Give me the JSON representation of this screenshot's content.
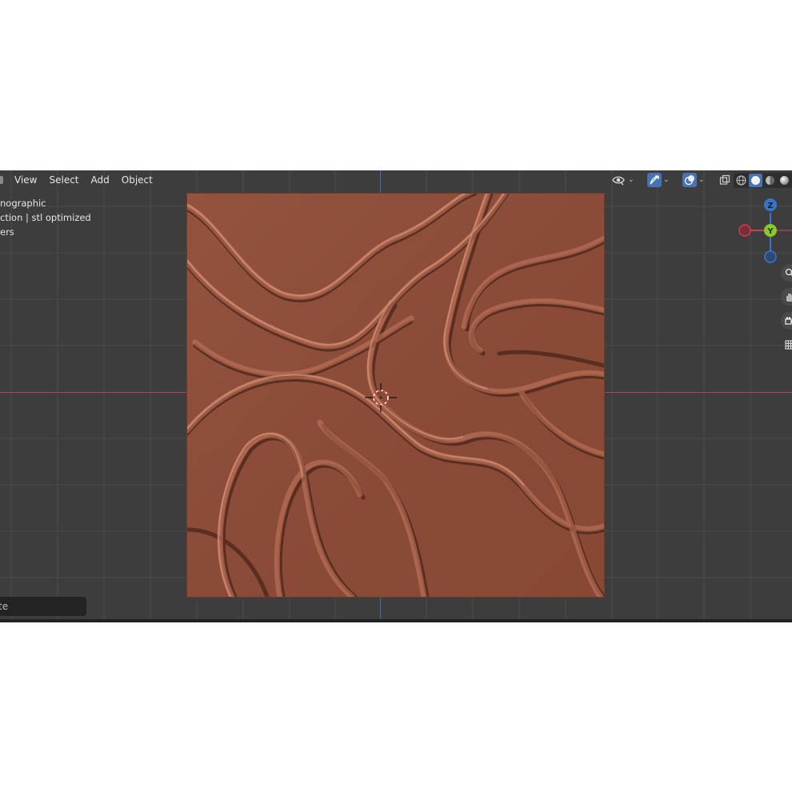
{
  "header": {
    "menu": [
      "View",
      "Select",
      "Add",
      "Object"
    ],
    "shading_modes": [
      {
        "name": "wireframe",
        "active": false
      },
      {
        "name": "solid",
        "active": true
      },
      {
        "name": "material-preview",
        "active": false
      },
      {
        "name": "rendered",
        "active": false
      }
    ]
  },
  "overlay": {
    "view_name": "nographic",
    "collection": "ction | stl optimized",
    "third_line": "ers"
  },
  "search": {
    "value": "te"
  },
  "gizmo": {
    "z_label": "Z",
    "y_label": "Y"
  },
  "colors": {
    "viewport_bg": "#3d3d3d",
    "panel": "#8a4c39",
    "x_axis": "#c9404f",
    "y_axis": "#8ac92c",
    "z_axis": "#3a76c4",
    "accent": "#4772b3"
  },
  "icons": [
    "eye-icon",
    "gizmo-toggle-icon",
    "overlay-icon",
    "xray-icon",
    "zoom-icon",
    "hand-icon",
    "camera-icon",
    "grid-icon"
  ]
}
